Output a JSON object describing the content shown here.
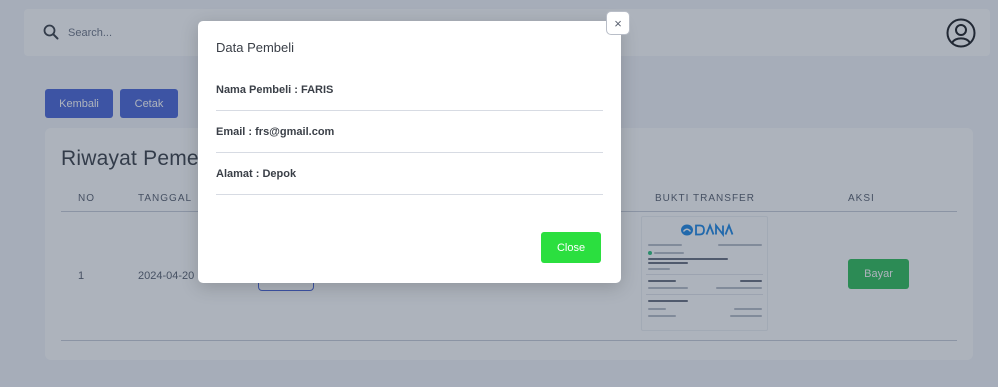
{
  "search": {
    "placeholder": "Search..."
  },
  "toolbar": {
    "kembali_label": "Kembali",
    "cetak_label": "Cetak"
  },
  "card": {
    "title": "Riwayat Pemesanan",
    "columns": {
      "no": "NO",
      "tanggal": "TANGGAL",
      "bukti": "BUKTI TRANSFER",
      "aksi": "AKSI"
    },
    "rows": [
      {
        "no": "1",
        "tanggal": "2024-04-20",
        "aksi_label": "Bayar"
      }
    ]
  },
  "modal": {
    "title": "Data Pembeli",
    "nama": "Nama Pembeli : FARIS",
    "email": "Email : frs@gmail.com",
    "alamat": "Alamat : Depok",
    "close_label": "Close",
    "x_glyph": "×"
  },
  "colors": {
    "primary": "#4b66d9",
    "success": "#2fbf5a",
    "close": "#2bdf3f",
    "backdrop": "#283750"
  },
  "icons": [
    "search-icon",
    "avatar-icon",
    "close-icon",
    "dana-logo"
  ]
}
